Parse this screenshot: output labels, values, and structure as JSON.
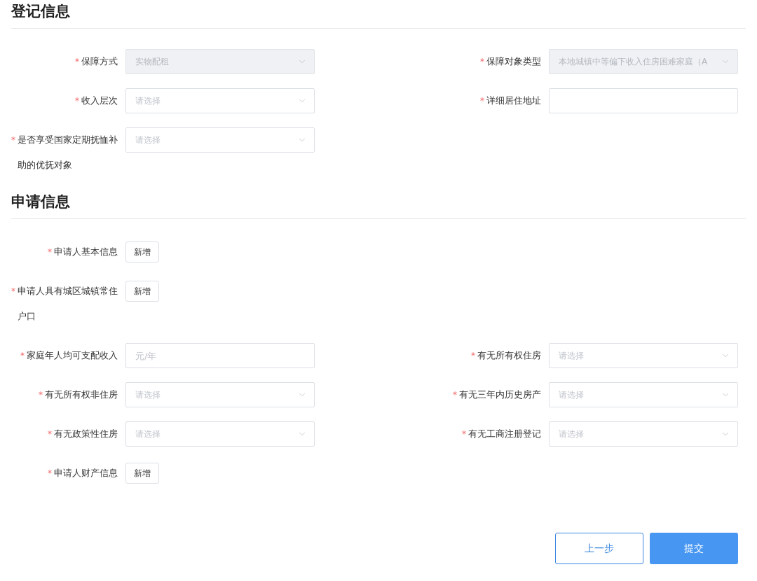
{
  "sections": [
    {
      "title": "登记信息",
      "rows": [
        [
          {
            "kind": "select",
            "label": "保障方式",
            "mark": "*",
            "disabled": true,
            "value": "实物配租"
          },
          {
            "kind": "select",
            "label": "保障对象类型",
            "mark": "*",
            "disabled": true,
            "value": "本地城镇中等偏下收入住房困难家庭（A"
          }
        ],
        [
          {
            "kind": "select",
            "label": "收入层次",
            "mark": "*",
            "disabled": false,
            "placeholder": "请选择"
          },
          {
            "kind": "input",
            "label": "详细居住地址",
            "mark": "*",
            "disabled": false
          }
        ],
        [
          {
            "kind": "select",
            "label": "是否享受国家定期抚恤补助的优抚对象",
            "mark": "*",
            "disabled": false,
            "placeholder": "请选择"
          }
        ]
      ]
    },
    {
      "title": "申请信息",
      "rows": [
        [
          {
            "kind": "button",
            "label": "申请人基本信息",
            "mark": "*",
            "button": "新增"
          }
        ],
        [
          {
            "kind": "button",
            "label": "申请人具有城区城镇常住户口",
            "mark": "*",
            "button": "新增"
          }
        ],
        [
          {
            "kind": "input",
            "label": "家庭年人均可支配收入",
            "mark": "*",
            "disabled": false,
            "placeholder": "元/年"
          },
          {
            "kind": "select",
            "label": "有无所有权住房",
            "mark": "*",
            "disabled": false,
            "placeholder": "请选择"
          }
        ],
        [
          {
            "kind": "select",
            "label": "有无所有权非住房",
            "mark": "*",
            "disabled": false,
            "placeholder": "请选择"
          },
          {
            "kind": "select",
            "label": "有无三年内历史房产",
            "mark": "*",
            "disabled": false,
            "placeholder": "请选择"
          }
        ],
        [
          {
            "kind": "select",
            "label": "有无政策性住房",
            "mark": "*",
            "disabled": false,
            "placeholder": "请选择"
          },
          {
            "kind": "select",
            "label": "有无工商注册登记",
            "mark": "*",
            "disabled": false,
            "placeholder": "请选择"
          }
        ],
        [
          {
            "kind": "button",
            "label": "申请人财产信息",
            "mark": "*",
            "button": "新增"
          }
        ]
      ]
    }
  ],
  "footer": {
    "back": "上一步",
    "submit": "提交"
  }
}
